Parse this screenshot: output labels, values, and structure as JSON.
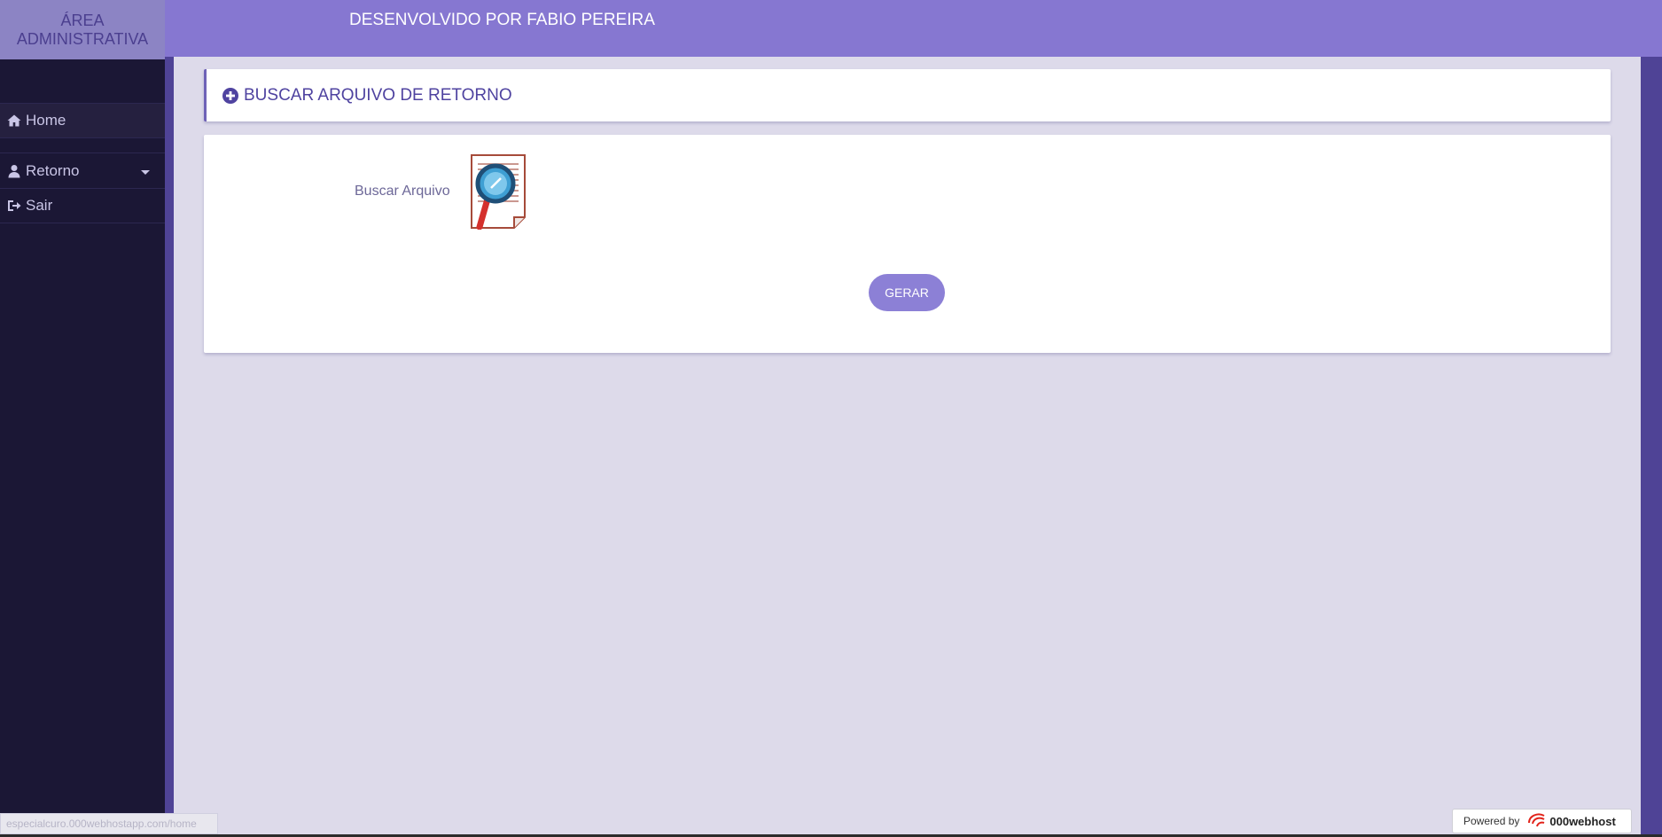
{
  "sidebar": {
    "brand_line1": "ÁREA",
    "brand_line2": "ADMINISTRATIVA",
    "items": [
      {
        "label": "Home",
        "icon": "home-icon"
      },
      {
        "label": "Retorno",
        "icon": "user-icon"
      },
      {
        "label": "Sair",
        "icon": "sign-out-icon"
      }
    ]
  },
  "header": {
    "title": "DESENVOLVIDO POR FABIO PEREIRA"
  },
  "panel": {
    "title": "BUSCAR ARQUIVO DE RETORNO",
    "file_label": "Buscar Arquivo",
    "submit_label": "GERAR"
  },
  "footer": {
    "powered_by": "Powered by",
    "host_name": "000webhost",
    "status_url": "especialcuro.000webhostapp.com/home"
  },
  "colors": {
    "accent": "#8677d1",
    "sidebar_bg": "#1b1735",
    "button": "#8c80d6",
    "title_text": "#4f43a0"
  }
}
